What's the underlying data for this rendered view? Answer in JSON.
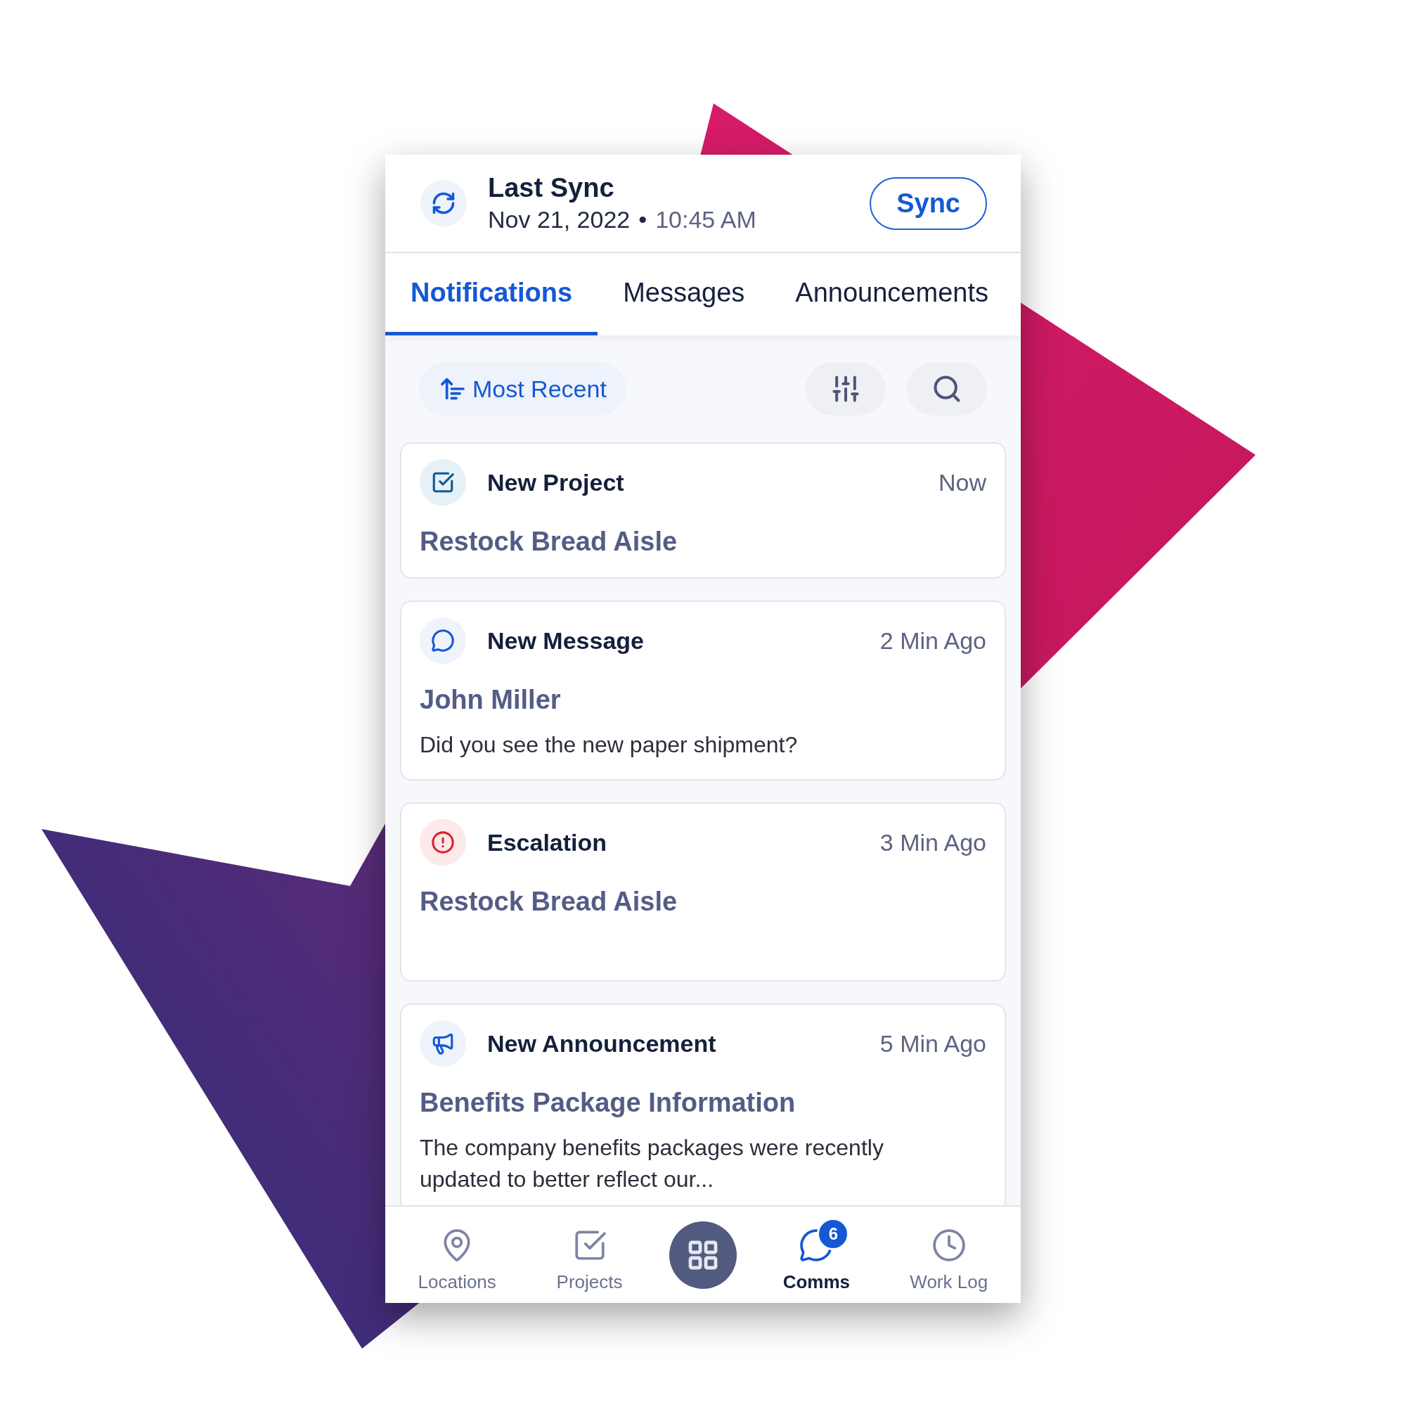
{
  "header": {
    "title": "Last Sync",
    "date": "Nov 21, 2022",
    "separator": "•",
    "time": "10:45 AM",
    "sync_button": "Sync"
  },
  "tabs": [
    {
      "label": "Notifications",
      "selected": true
    },
    {
      "label": "Messages",
      "selected": false
    },
    {
      "label": "Announcements",
      "selected": false
    }
  ],
  "sort": {
    "label": "Most Recent"
  },
  "notifications": [
    {
      "kind": "project",
      "title": "New Project",
      "time": "Now",
      "subject": "Restock Bread Aisle"
    },
    {
      "kind": "message",
      "title": "New Message",
      "time": "2 Min Ago",
      "subject": "John Miller",
      "body": "Did you see the new paper shipment?"
    },
    {
      "kind": "escalation",
      "title": "Escalation",
      "time": "3 Min Ago",
      "subject": "Restock Bread Aisle"
    },
    {
      "kind": "announcement",
      "title": "New Announcement",
      "time": "5 Min Ago",
      "subject": "Benefits Package Information",
      "body": "The company benefits packages were recently updated to better reflect our..."
    }
  ],
  "nav": [
    {
      "kind": "location",
      "label": "Locations",
      "selected": false
    },
    {
      "kind": "project",
      "label": "Projects",
      "selected": false
    },
    {
      "kind": "apps",
      "selected": false
    },
    {
      "kind": "comms",
      "label": "Comms",
      "selected": true,
      "badge": "6"
    },
    {
      "kind": "worklog",
      "label": "Work Log",
      "selected": false
    }
  ]
}
